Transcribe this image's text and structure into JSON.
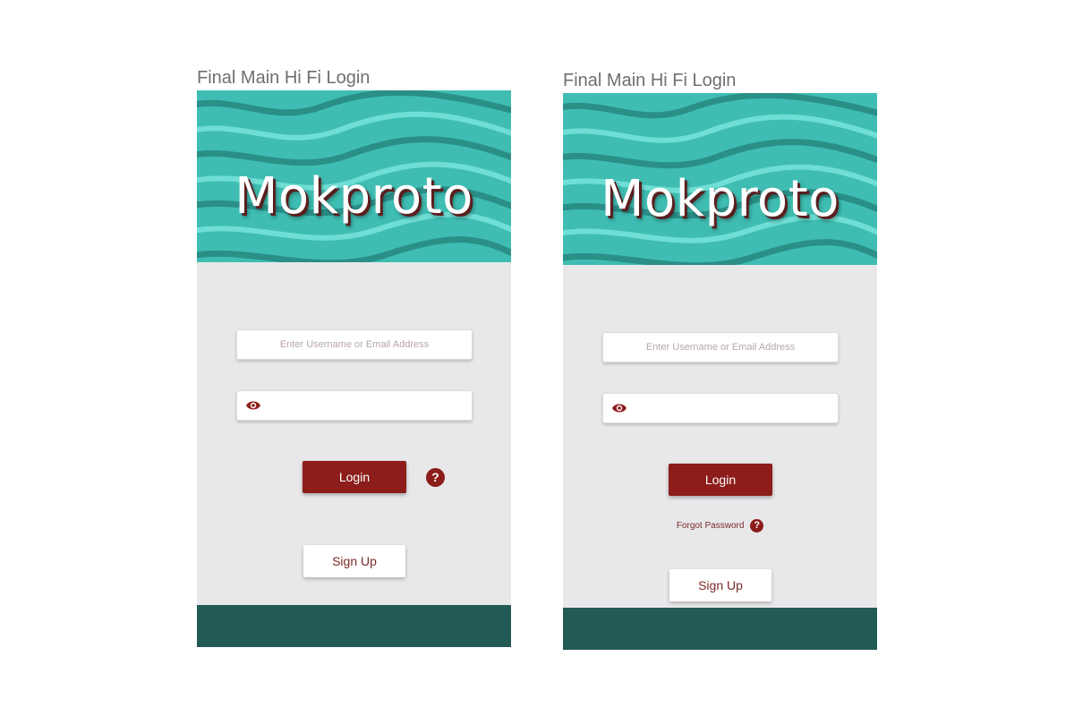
{
  "frames": [
    {
      "title": "Final Main Hi Fi Login",
      "logo": "Mokproto",
      "username_placeholder": "Enter Username or Email Address",
      "password_icon": "eye-icon",
      "login_label": "Login",
      "help_icon": "question-circle-icon",
      "help_glyph": "?",
      "signup_label": "Sign Up"
    },
    {
      "title": "Final Main Hi Fi Login",
      "logo": "Mokproto",
      "username_placeholder": "Enter Username or Email Address",
      "password_icon": "eye-icon",
      "login_label": "Login",
      "forgot_label": "Forgot Password",
      "help_icon": "question-circle-icon",
      "help_glyph": "?",
      "signup_label": "Sign Up"
    }
  ],
  "colors": {
    "accent": "#8c1d1a",
    "hero": "#3fbdb2",
    "footer": "#245a55",
    "body": "#e8e8ea"
  }
}
